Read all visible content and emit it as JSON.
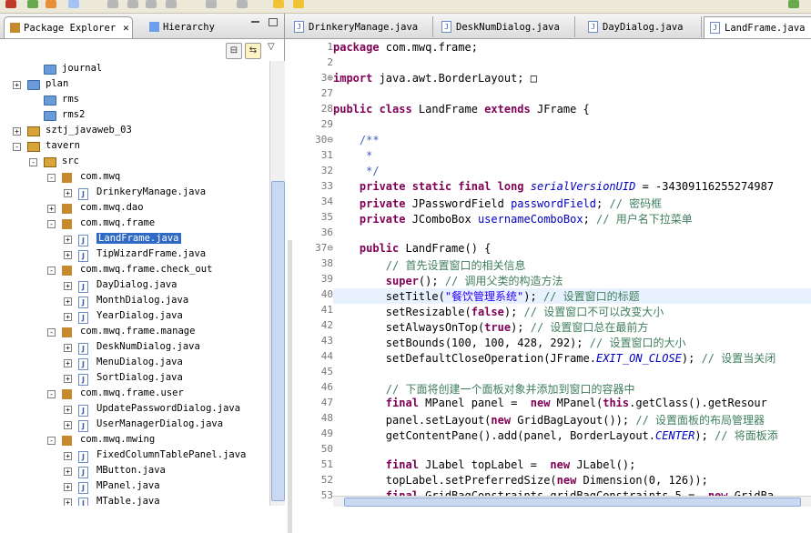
{
  "left_tabs": [
    {
      "label": "Package Explorer",
      "active": true
    },
    {
      "label": "Hierarchy",
      "active": false
    }
  ],
  "tree": [
    {
      "label": "journal",
      "icon": "folder-icon",
      "depth": 1,
      "toggle": ""
    },
    {
      "label": "plan",
      "icon": "folder-icon",
      "depth": 0,
      "toggle": "+"
    },
    {
      "label": "rms",
      "icon": "folder-icon",
      "depth": 1,
      "toggle": ""
    },
    {
      "label": "rms2",
      "icon": "folder-icon",
      "depth": 1,
      "toggle": ""
    },
    {
      "label": "sztj_javaweb_03",
      "icon": "project-icon",
      "depth": 0,
      "toggle": "+"
    },
    {
      "label": "tavern",
      "icon": "project-icon",
      "depth": 0,
      "toggle": "-"
    },
    {
      "label": "src",
      "icon": "src-folder-icon",
      "depth": 1,
      "toggle": "-"
    },
    {
      "label": "com.mwq",
      "icon": "package-icon",
      "depth": 2,
      "toggle": "-"
    },
    {
      "label": "DrinkeryManage.java",
      "icon": "java-file-icon",
      "depth": 3,
      "toggle": "+"
    },
    {
      "label": "com.mwq.dao",
      "icon": "package-icon",
      "depth": 2,
      "toggle": "+"
    },
    {
      "label": "com.mwq.frame",
      "icon": "package-icon",
      "depth": 2,
      "toggle": "-"
    },
    {
      "label": "LandFrame.java",
      "icon": "java-file-icon",
      "depth": 3,
      "toggle": "+",
      "selected": true
    },
    {
      "label": "TipWizardFrame.java",
      "icon": "java-file-icon",
      "depth": 3,
      "toggle": "+"
    },
    {
      "label": "com.mwq.frame.check_out",
      "icon": "package-icon",
      "depth": 2,
      "toggle": "-"
    },
    {
      "label": "DayDialog.java",
      "icon": "java-file-icon",
      "depth": 3,
      "toggle": "+"
    },
    {
      "label": "MonthDialog.java",
      "icon": "java-file-icon",
      "depth": 3,
      "toggle": "+"
    },
    {
      "label": "YearDialog.java",
      "icon": "java-file-icon",
      "depth": 3,
      "toggle": "+"
    },
    {
      "label": "com.mwq.frame.manage",
      "icon": "package-icon",
      "depth": 2,
      "toggle": "-"
    },
    {
      "label": "DeskNumDialog.java",
      "icon": "java-file-icon",
      "depth": 3,
      "toggle": "+"
    },
    {
      "label": "MenuDialog.java",
      "icon": "java-file-icon",
      "depth": 3,
      "toggle": "+"
    },
    {
      "label": "SortDialog.java",
      "icon": "java-file-icon",
      "depth": 3,
      "toggle": "+"
    },
    {
      "label": "com.mwq.frame.user",
      "icon": "package-icon",
      "depth": 2,
      "toggle": "-"
    },
    {
      "label": "UpdatePasswordDialog.java",
      "icon": "java-file-icon",
      "depth": 3,
      "toggle": "+"
    },
    {
      "label": "UserManagerDialog.java",
      "icon": "java-file-icon",
      "depth": 3,
      "toggle": "+"
    },
    {
      "label": "com.mwq.mwing",
      "icon": "package-icon",
      "depth": 2,
      "toggle": "-"
    },
    {
      "label": "FixedColumnTablePanel.java",
      "icon": "java-file-icon",
      "depth": 3,
      "toggle": "+"
    },
    {
      "label": "MButton.java",
      "icon": "java-file-icon",
      "depth": 3,
      "toggle": "+"
    },
    {
      "label": "MPanel.java",
      "icon": "java-file-icon",
      "depth": 3,
      "toggle": "+"
    },
    {
      "label": "MTable.java",
      "icon": "java-file-icon",
      "depth": 3,
      "toggle": "+"
    }
  ],
  "editor_tabs": [
    {
      "label": "DrinkeryManage.java",
      "active": false
    },
    {
      "label": "DeskNumDialog.java",
      "active": false
    },
    {
      "label": "DayDialog.java",
      "active": false
    },
    {
      "label": "LandFrame.java",
      "active": true
    }
  ],
  "code_lines": [
    {
      "no": "1",
      "fold": "",
      "segs": [
        [
          "kw",
          "package"
        ],
        [
          "",
          "com.mwq.frame;"
        ]
      ]
    },
    {
      "no": "2",
      "fold": "",
      "segs": []
    },
    {
      "no": "3",
      "fold": "+",
      "segs": [
        [
          "kw",
          "import"
        ],
        [
          "",
          "java.awt.BorderLayout;"
        ],
        [
          "",
          "□"
        ]
      ]
    },
    {
      "no": "27",
      "fold": "",
      "segs": []
    },
    {
      "no": "28",
      "fold": "",
      "segs": [
        [
          "kw",
          "public class"
        ],
        [
          "",
          "LandFrame"
        ],
        [
          "kw",
          "extends"
        ],
        [
          "",
          "JFrame {"
        ]
      ]
    },
    {
      "no": "29",
      "fold": "",
      "segs": []
    },
    {
      "no": "30",
      "fold": "-",
      "segs": [
        [
          "jd",
          "    /**"
        ]
      ]
    },
    {
      "no": "31",
      "fold": "",
      "segs": [
        [
          "jd",
          "     *"
        ]
      ]
    },
    {
      "no": "32",
      "fold": "",
      "segs": [
        [
          "jd",
          "     */"
        ]
      ]
    },
    {
      "no": "33",
      "fold": "",
      "segs": [
        [
          "kw",
          "    private static final long"
        ],
        [
          "sf",
          "serialVersionUID"
        ],
        [
          "",
          "= -34309116255274987"
        ]
      ]
    },
    {
      "no": "34",
      "fold": "",
      "segs": [
        [
          "kw",
          "    private"
        ],
        [
          "",
          "JPasswordField"
        ],
        [
          "fi",
          "passwordField"
        ],
        [
          "",
          ";"
        ],
        [
          "cm",
          "// 密码框"
        ]
      ]
    },
    {
      "no": "35",
      "fold": "",
      "segs": [
        [
          "kw",
          "    private"
        ],
        [
          "",
          "JComboBox"
        ],
        [
          "fi",
          "usernameComboBox"
        ],
        [
          "",
          ";"
        ],
        [
          "cm",
          "// 用户名下拉菜单"
        ]
      ]
    },
    {
      "no": "36",
      "fold": "",
      "segs": []
    },
    {
      "no": "37",
      "fold": "-",
      "segs": [
        [
          "kw",
          "    public"
        ],
        [
          "",
          "LandFrame() {"
        ]
      ]
    },
    {
      "no": "38",
      "fold": "",
      "segs": [
        [
          "cm",
          "        // 首先设置窗口的相关信息"
        ]
      ]
    },
    {
      "no": "39",
      "fold": "",
      "segs": [
        [
          "kw",
          "        super"
        ],
        [
          "",
          "();"
        ],
        [
          "cm",
          "// 调用父类的构造方法"
        ]
      ]
    },
    {
      "no": "40",
      "fold": "",
      "segs": [
        [
          "",
          "        setTitle("
        ],
        [
          "st",
          "\"餐饮管理系统\""
        ],
        [
          "",
          ");"
        ],
        [
          "cm",
          "// 设置窗口的标题"
        ]
      ],
      "highlight": true
    },
    {
      "no": "41",
      "fold": "",
      "segs": [
        [
          "",
          "        setResizable("
        ],
        [
          "kw",
          "false"
        ],
        [
          "",
          ");"
        ],
        [
          "cm",
          "// 设置窗口不可以改变大小"
        ]
      ]
    },
    {
      "no": "42",
      "fold": "",
      "segs": [
        [
          "",
          "        setAlwaysOnTop("
        ],
        [
          "kw",
          "true"
        ],
        [
          "",
          ");"
        ],
        [
          "cm",
          "// 设置窗口总在最前方"
        ]
      ]
    },
    {
      "no": "43",
      "fold": "",
      "segs": [
        [
          "",
          "        setBounds(100, 100, 428, 292);"
        ],
        [
          "cm",
          "// 设置窗口的大小"
        ]
      ]
    },
    {
      "no": "44",
      "fold": "",
      "segs": [
        [
          "",
          "        setDefaultCloseOperation(JFrame."
        ],
        [
          "sf",
          "EXIT_ON_CLOSE"
        ],
        [
          "",
          ");"
        ],
        [
          "cm",
          "// 设置当关闭"
        ]
      ]
    },
    {
      "no": "45",
      "fold": "",
      "segs": []
    },
    {
      "no": "46",
      "fold": "",
      "segs": [
        [
          "cm",
          "        // 下面将创建一个面板对象并添加到窗口的容器中"
        ]
      ]
    },
    {
      "no": "47",
      "fold": "",
      "segs": [
        [
          "kw",
          "        final"
        ],
        [
          "",
          "MPanel panel = "
        ],
        [
          "kw",
          "new"
        ],
        [
          "",
          "MPanel("
        ],
        [
          "kw",
          "this"
        ],
        [
          "",
          ".getClass().getResour"
        ]
      ]
    },
    {
      "no": "48",
      "fold": "",
      "segs": [
        [
          "",
          "        panel.setLayout("
        ],
        [
          "kw",
          "new"
        ],
        [
          "",
          "GridBagLayout());"
        ],
        [
          "cm",
          "// 设置面板的布局管理器"
        ]
      ]
    },
    {
      "no": "49",
      "fold": "",
      "segs": [
        [
          "",
          "        getContentPane().add(panel, BorderLayout."
        ],
        [
          "sf",
          "CENTER"
        ],
        [
          "",
          ");"
        ],
        [
          "cm",
          "// 将面板添"
        ]
      ]
    },
    {
      "no": "50",
      "fold": "",
      "segs": []
    },
    {
      "no": "51",
      "fold": "",
      "segs": [
        [
          "kw",
          "        final"
        ],
        [
          "",
          "JLabel topLabel = "
        ],
        [
          "kw",
          "new"
        ],
        [
          "",
          "JLabel();"
        ]
      ]
    },
    {
      "no": "52",
      "fold": "",
      "segs": [
        [
          "",
          "        topLabel.setPreferredSize("
        ],
        [
          "kw",
          "new"
        ],
        [
          "",
          "Dimension(0, 126));"
        ]
      ]
    },
    {
      "no": "53",
      "fold": "",
      "segs": [
        [
          "kw",
          "        final"
        ],
        [
          "",
          "GridBagConstraints gridBagConstraints_5 = "
        ],
        [
          "kw",
          "new"
        ],
        [
          "",
          "GridBa"
        ]
      ]
    }
  ],
  "colors": {
    "selection": "#316ac5",
    "keyword": "#7f0055",
    "comment": "#3f7f5f",
    "javadoc": "#3f5fbf",
    "string": "#2a00ff",
    "field": "#0000c0"
  }
}
